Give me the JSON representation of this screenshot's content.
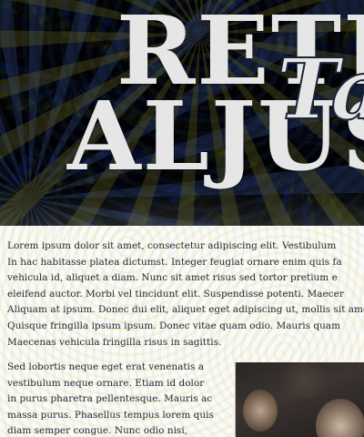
{
  "hero": {
    "title_line_1": "RETI",
    "title_line_2": "ALJUS",
    "script_overlay_glyph": "Ta"
  },
  "article": {
    "paragraph_1_lines": [
      "Lorem ipsum dolor sit amet, consectetur adipiscing elit. Vestibulum",
      "In hac habitasse platea dictumst. Integer feugiat ornare enim quis fa",
      "vehicula id, aliquet a diam. Nunc sit amet risus sed tortor pretium e",
      "eleifend auctor. Morbi vel tincidunt elit. Suspendisse potenti. Maecer",
      "Aliquam at ipsum. Donec dui elit, aliquet eget adipiscing ut, mollis sit amet mi.",
      "Quisque fringilla ipsum ipsum. Donec vitae quam odio. Mauris quam",
      "Maecenas vehicula fringilla risus in sagittis."
    ],
    "paragraph_2_lines": [
      "Sed lobortis neque eget erat venenatis a",
      "vestibulum neque ornare. Etiam id dolor",
      "in purus pharetra pellentesque. Mauris ac",
      "massa purus. Phasellus tempus lorem quis",
      "diam semper congue. Nunc odio nisi,"
    ]
  }
}
